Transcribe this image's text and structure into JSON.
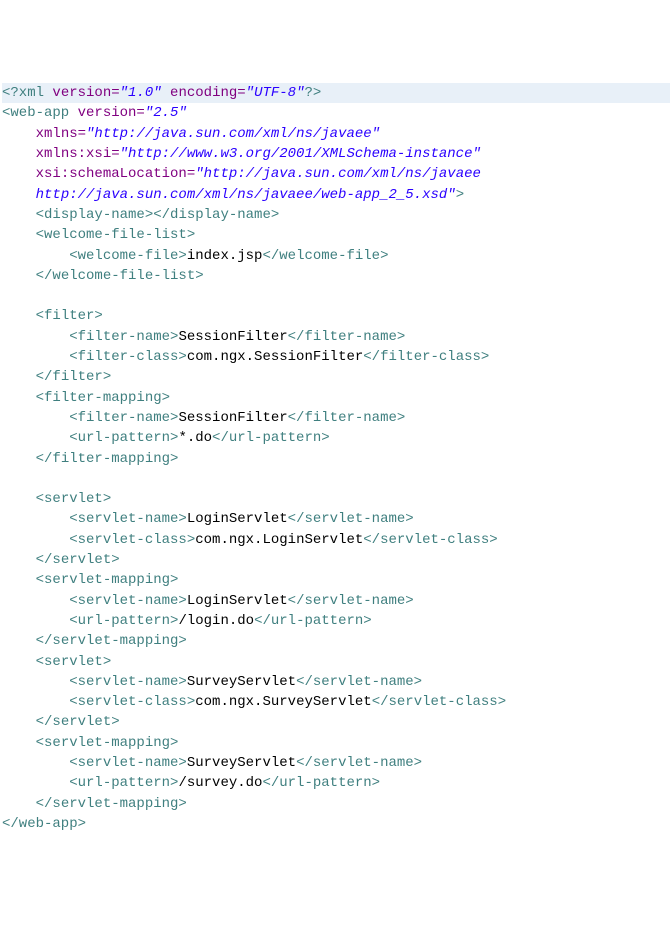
{
  "xml_decl": {
    "open": "<?xml",
    "attr_version": " version=",
    "version": "\"1.0\"",
    "attr_encoding": " encoding=",
    "encoding": "\"UTF-8\"",
    "close": "?>"
  },
  "webapp": {
    "open": "<web-app",
    "attr_version": " version=",
    "version": "\"2.5\"",
    "attr_xmlns": "xmlns=",
    "xmlns": "\"http://java.sun.com/xml/ns/javaee\"",
    "attr_xmlns_xsi": "xmlns:xsi=",
    "xmlns_xsi": "\"http://www.w3.org/2001/XMLSchema-instance\"",
    "attr_schema": "xsi:schemaLocation=",
    "schema1": "\"http://java.sun.com/xml/ns/javaee ",
    "schema2": "http://java.sun.com/xml/ns/javaee/web-app_2_5.xsd\"",
    "gt": ">"
  },
  "display_name": {
    "open": "<display-name>",
    "close": "</display-name>"
  },
  "welcome_file_list": {
    "open": "<welcome-file-list>",
    "close": "</welcome-file-list>"
  },
  "welcome_file": {
    "open": "<welcome-file>",
    "value": "index.jsp",
    "close": "</welcome-file>"
  },
  "filter": {
    "open": "<filter>",
    "close": "</filter>"
  },
  "filter_name": {
    "open": "<filter-name>",
    "close": "</filter-name>"
  },
  "filter_class": {
    "open": "<filter-class>",
    "close": "</filter-class>"
  },
  "filter_mapping": {
    "open": "<filter-mapping>",
    "close": "</filter-mapping>"
  },
  "url_pattern": {
    "open": "<url-pattern>",
    "close": "</url-pattern>"
  },
  "servlet": {
    "open": "<servlet>",
    "close": "</servlet>"
  },
  "servlet_name": {
    "open": "<servlet-name>",
    "close": "</servlet-name>"
  },
  "servlet_class": {
    "open": "<servlet-class>",
    "close": "</servlet-class>"
  },
  "servlet_mapping": {
    "open": "<servlet-mapping>",
    "close": "</servlet-mapping>"
  },
  "webapp_close": "</web-app>",
  "values": {
    "session_filter": "SessionFilter",
    "session_filter_class": "com.ngx.SessionFilter",
    "star_do": "*.do",
    "login_servlet": "LoginServlet",
    "login_servlet_class": "com.ngx.LoginServlet",
    "login_do": "/login.do",
    "survey_servlet": "SurveyServlet",
    "survey_servlet_class": "com.ngx.SurveyServlet",
    "survey_do": "/survey.do"
  },
  "indent1": "    ",
  "indent2": "        "
}
